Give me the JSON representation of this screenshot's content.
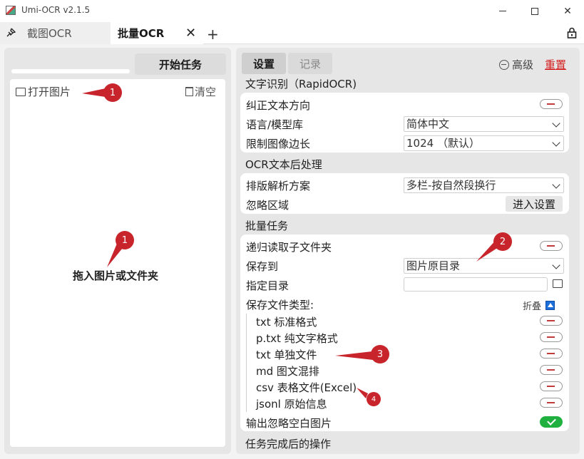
{
  "window": {
    "title": "Umi-OCR v2.1.5"
  },
  "tabs": [
    {
      "label": "截图OCR"
    },
    {
      "label": "批量OCR"
    }
  ],
  "left": {
    "start_button": "开始任务",
    "open_images": "打开图片",
    "clear": "清空",
    "drop_hint": "拖入图片或文件夹"
  },
  "right": {
    "tab_settings": "设置",
    "tab_history": "记录",
    "advanced": "高级",
    "reset": "重置",
    "sections": {
      "ocr": "文字识别（RapidOCR)",
      "post": "OCR文本后处理",
      "batch": "批量任务",
      "after": "任务完成后的操作"
    },
    "ocr": {
      "correct_direction": "纠正文本方向",
      "language_label": "语言/模型库",
      "language_value": "简体中文",
      "limit_label": "限制图像边长",
      "limit_value": "1024 （默认）"
    },
    "post": {
      "layout_label": "排版解析方案",
      "layout_value": "多栏-按自然段换行",
      "ignore_label": "忽略区域",
      "ignore_button": "进入设置"
    },
    "batch": {
      "recursive": "递归读取子文件夹",
      "save_to_label": "保存到",
      "save_to_value": "图片原目录",
      "dir_label": "指定目录",
      "dir_value": "",
      "filetypes_label": "保存文件类型:",
      "collapse": "折叠",
      "filetypes": [
        "txt 标准格式",
        "p.txt 纯文字格式",
        "txt 单独文件",
        "md 图文混排",
        "csv 表格文件(Excel)",
        "jsonl 原始信息"
      ],
      "output_ignored": "输出忽略空白图片"
    }
  },
  "annotations": [
    "1",
    "1",
    "2",
    "3",
    "4"
  ]
}
